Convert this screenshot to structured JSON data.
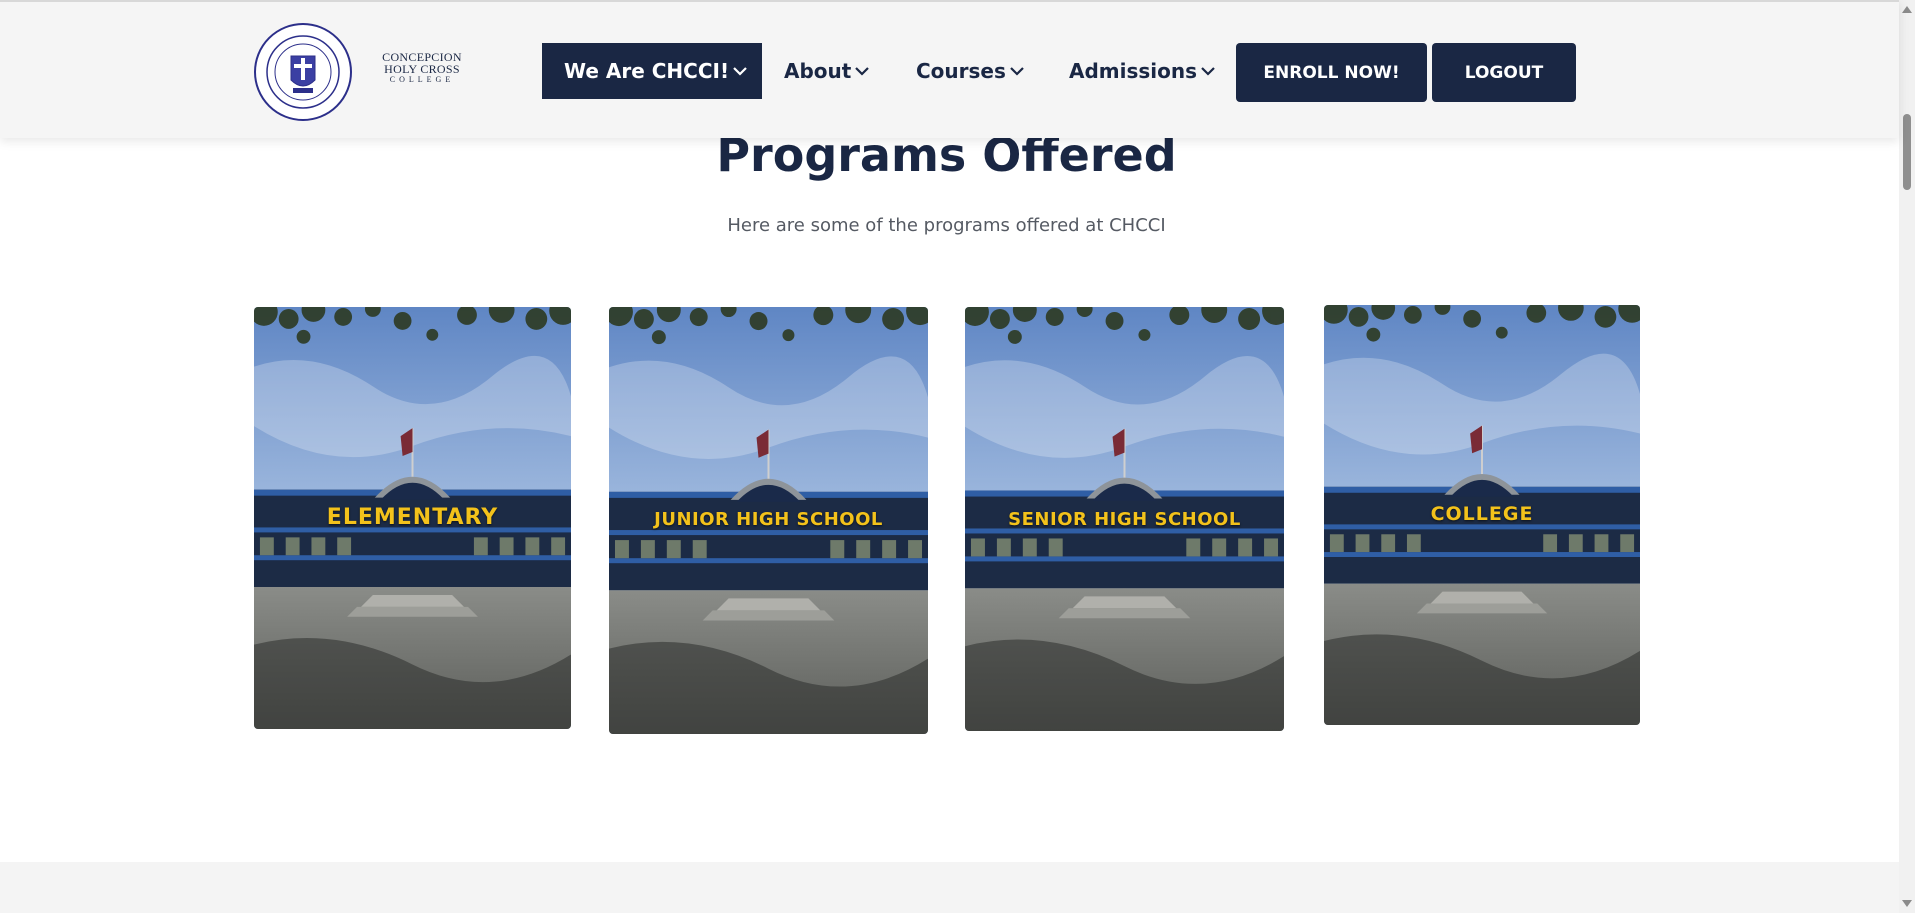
{
  "header": {
    "seal_icon": "college-seal-icon",
    "wordmark": {
      "line1": "CONCEPCION",
      "line2": "HOLY CROSS",
      "line3": "COLLEGE"
    },
    "nav": [
      {
        "label": "We Are CHCCI!",
        "active": true
      },
      {
        "label": "About",
        "active": false
      },
      {
        "label": "Courses",
        "active": false
      },
      {
        "label": "Admissions",
        "active": false
      }
    ],
    "enroll_label": "ENROLL NOW!",
    "logout_label": "LOGOUT"
  },
  "section": {
    "title": "Programs Offered",
    "subtitle": "Here are some of the programs offered at CHCCI"
  },
  "programs": [
    {
      "label": "ELEMENTARY",
      "image": "campus-building-photo"
    },
    {
      "label": "JUNIOR HIGH SCHOOL",
      "image": "campus-building-photo"
    },
    {
      "label": "SENIOR HIGH SCHOOL",
      "image": "campus-building-photo"
    },
    {
      "label": "COLLEGE",
      "image": "campus-building-photo"
    }
  ],
  "colors": {
    "navy": "#1a2744",
    "label_yellow": "#f3c21b",
    "header_bg": "#f5f5f5"
  }
}
